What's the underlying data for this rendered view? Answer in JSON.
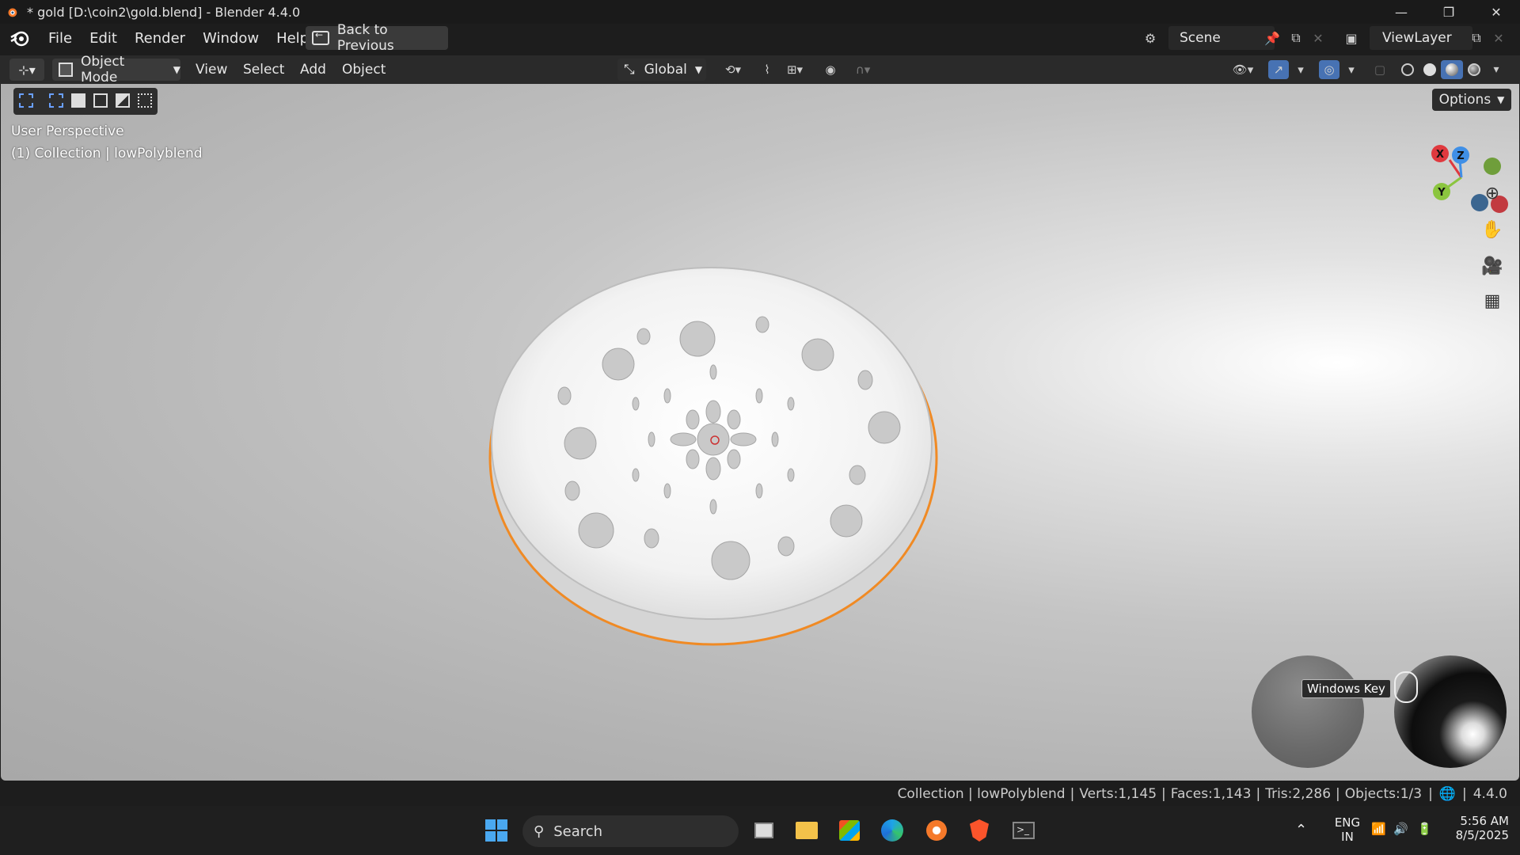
{
  "window": {
    "title": "* gold [D:\\coin2\\gold.blend] - Blender 4.4.0",
    "controls": [
      "—",
      "❐",
      "✕"
    ]
  },
  "menu": {
    "items": [
      "File",
      "Edit",
      "Render",
      "Window",
      "Help"
    ],
    "back_button": "Back to Previous",
    "scene": "Scene",
    "view_layer": "ViewLayer"
  },
  "viewport_header": {
    "mode": "Object Mode",
    "menus": [
      "View",
      "Select",
      "Add",
      "Object"
    ],
    "orientation": "Global",
    "options": "Options"
  },
  "viewport": {
    "perspective": "User Perspective",
    "collection_line": "(1) Collection | lowPolyblend",
    "gizmo_axes": [
      "X",
      "Y",
      "Z"
    ],
    "windows_key_label": "Windows Key"
  },
  "statusbar": {
    "collection": "Collection | lowPolyblend",
    "verts": "Verts:1,145",
    "faces": "Faces:1,143",
    "tris": "Tris:2,286",
    "objects": "Objects:1/3",
    "version": "4.4.0"
  },
  "taskbar": {
    "search_placeholder": "Search",
    "lang_top": "ENG",
    "lang_bottom": "IN",
    "time": "5:56 AM",
    "date": "8/5/2025"
  },
  "colors": {
    "selection_outline": "#f08a24",
    "accent_blue": "#4772b3",
    "axis_x": "#e0393e",
    "axis_y": "#8bc53f",
    "axis_z": "#3f8fe6"
  }
}
